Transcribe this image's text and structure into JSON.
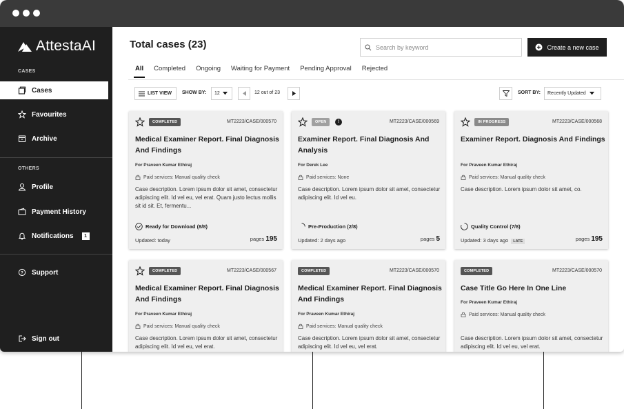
{
  "app": {
    "name": "AttestaAI"
  },
  "sidebar": {
    "section_cases": "CASES",
    "section_others": "OTHERS",
    "items": [
      {
        "label": "Cases",
        "icon": "case-icon"
      },
      {
        "label": "Favourites",
        "icon": "star-icon"
      },
      {
        "label": "Archive",
        "icon": "archive-icon"
      },
      {
        "label": "Profile",
        "icon": "user-icon"
      },
      {
        "label": "Payment History",
        "icon": "wallet-icon"
      },
      {
        "label": "Notifications",
        "icon": "bell-icon",
        "count": "1"
      },
      {
        "label": "Support",
        "icon": "help-icon"
      },
      {
        "label": "Sign out",
        "icon": "sign-out-icon"
      }
    ]
  },
  "header": {
    "title": "Total cases (23)",
    "search_placeholder": "Search by keyword",
    "create_label": "Create a new case"
  },
  "tabs": [
    "All",
    "Completed",
    "Ongoing",
    "Waiting for Payment",
    "Pending Approval",
    "Rejected"
  ],
  "toolbar": {
    "list_view": "LIST VIEW",
    "show_by_label": "SHOW BY:",
    "show_by_value": "12",
    "pager_text": "12 out of 23",
    "sort_by_label": "SORT BY:",
    "sort_by_value": "Recently Updated"
  },
  "cards": [
    {
      "status": "COMPLETED",
      "id": "MT2223/CASE/000570",
      "title": "Medical Examiner Report. Final Diagnosis And Findings",
      "for": "For Praveen Kumar Ethiraj",
      "paid": "Paid services: Manual quality check",
      "desc": "Case description. Lorem ipsum dolor sit amet, consectetur adipiscing elit. Id vel eu, vel erat. Quam justo lectus mollis sit id sit. Et, fermentu...",
      "state": "Ready for Download (8/8)",
      "updated": "Updated: today",
      "pages_label": "pages",
      "pages": "195"
    },
    {
      "status": "OPEN",
      "info": "!",
      "id": "MT2223/CASE/000569",
      "title": "Examiner Report. Final Diagnosis And Analysis",
      "for": "For Derek Lee",
      "paid": "Paid services: None",
      "desc": "Case description. Lorem ipsum dolor sit amet, consectetur adipiscing elit. Id vel eu.",
      "state": "Pre-Production (2/8)",
      "updated": "Updated: 2 days ago",
      "pages_label": "pages",
      "pages": "5"
    },
    {
      "status": "IN PROGRESS",
      "id": "MT2223/CASE/000568",
      "title": "Examiner Report. Diagnosis And Findings",
      "for": "For Praveen Kumar Ethiraj",
      "paid": "Paid services: Manual quality check",
      "desc": "Case description. Lorem ipsum dolor sit amet, co.",
      "state": "Quality Control (7/8)",
      "updated": "Updated: 3 days ago",
      "late": "LATE",
      "pages_label": "pages",
      "pages": "195"
    },
    {
      "status": "COMPLETED",
      "id": "MT2223/CASE/000567",
      "title": "Medical Examiner Report. Final Diagnosis And Findings",
      "for": "For Praveen Kumar Ethiraj",
      "paid": "Paid services: Manual quality check",
      "desc": "Case description. Lorem ipsum dolor sit amet, consectetur adipiscing elit. Id vel eu, vel erat."
    },
    {
      "status": "COMPLETED",
      "id": "MT2223/CASE/000570",
      "title": "Medical Examiner Report. Final Diagnosis And Findings",
      "for": "For Praveen Kumar Ethiraj",
      "paid": "Paid services: Manual quality check",
      "desc": "Case description. Lorem ipsum dolor sit amet, consectetur adipiscing elit. Id vel eu, vel erat."
    },
    {
      "status": "COMPLETED",
      "id": "MT2223/CASE/000570",
      "title": "Case Title  Go Here In One Line",
      "for": "For Praveen Kumar Ethiraj",
      "paid": "Paid services: Manual quality check",
      "desc": "Case description. Lorem ipsum dolor sit amet, consectetur adipiscing elit. Id vel eu, vel erat."
    }
  ]
}
